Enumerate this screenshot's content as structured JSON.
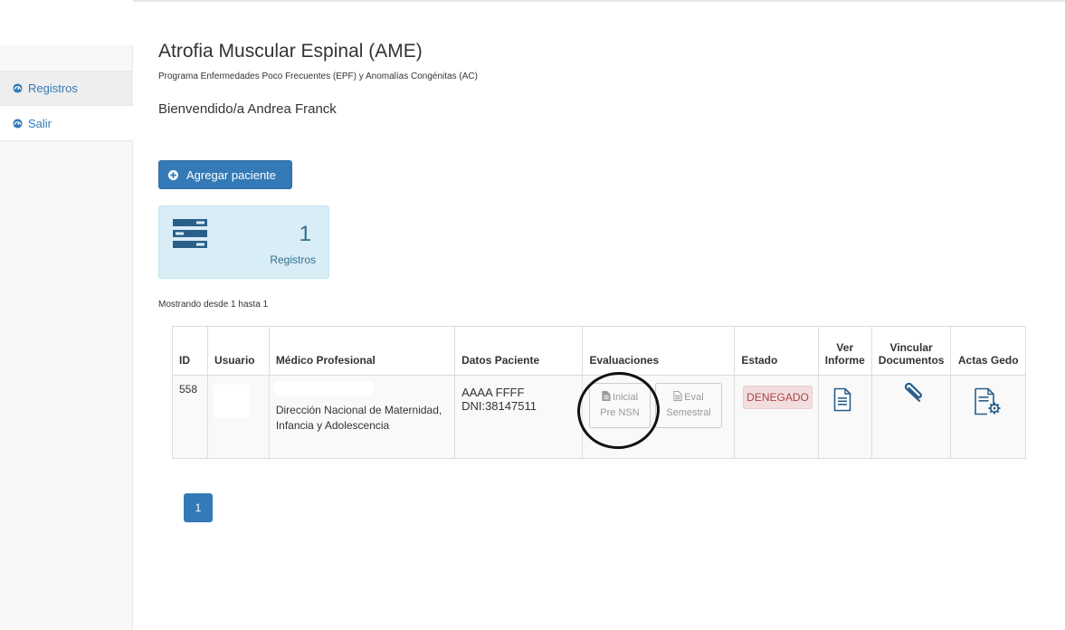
{
  "sidebar": {
    "items": [
      {
        "label": "Registros",
        "icon": "dashboard-icon"
      },
      {
        "label": "Salir",
        "icon": "dashboard-icon"
      }
    ]
  },
  "header": {
    "title": "Atrofia Muscular Espinal (AME)",
    "subtitle": "Programa Enfermedades Poco Frecuentes (EPF) y Anomalías Congénitas (AC)",
    "welcome": "Bienvendido/a Andrea Franck"
  },
  "actions": {
    "add_patient_label": "Agregar paciente"
  },
  "stats": {
    "count": "1",
    "label": "Registros"
  },
  "list_info": "Mostrando desde 1 hasta 1",
  "table": {
    "headers": {
      "id": "ID",
      "usuario": "Usuario",
      "medico": "Médico Profesional",
      "datos": "Datos Paciente",
      "evaluaciones": "Evaluaciones",
      "estado": "Estado",
      "ver_informe_1": "Ver",
      "ver_informe_2": "Informe",
      "vincular_1": "Vincular",
      "vincular_2": "Documentos",
      "actas": "Actas Gedo"
    },
    "rows": [
      {
        "id": "558",
        "medico": "Dirección Nacional de Maternidad, Infancia y Adolescencia",
        "paciente_nombre": "AAAA FFFF",
        "paciente_dni": "DNI:38147511",
        "eval_inicial_1": "Inicial",
        "eval_inicial_2": "Pre NSN",
        "eval_semestral_1": "Eval",
        "eval_semestral_2": "Semestral",
        "estado": "DENEGADO"
      }
    ]
  },
  "pagination": {
    "current": "1"
  },
  "colors": {
    "primary": "#337ab7",
    "info_bg": "#d9edf7",
    "danger_bg": "#f2dede",
    "danger_text": "#a94442"
  }
}
